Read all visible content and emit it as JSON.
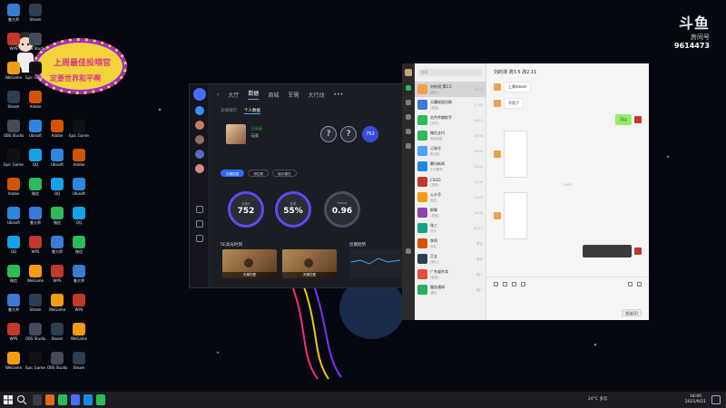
{
  "stream_overlay": {
    "banner_line1": "上周最佳投喂官",
    "banner_line2": "定要世界和平啊",
    "logo_brand": "斗鱼",
    "logo_room": "房间号",
    "room_id": "9614473"
  },
  "desktop_icons": [
    {
      "label": "鲁大师",
      "color": "#3a7bd5"
    },
    {
      "label": "WPS",
      "color": "#c0392b"
    },
    {
      "label": "WeGame",
      "color": "#f39c12"
    },
    {
      "label": "Steam",
      "color": "#2c3e50"
    },
    {
      "label": "OBS Studio",
      "color": "#444a58"
    },
    {
      "label": "Epic Games",
      "color": "#111111"
    },
    {
      "label": "Adobe",
      "color": "#d35400"
    },
    {
      "label": "Ubisoft",
      "color": "#2e86de"
    },
    {
      "label": "QQ",
      "color": "#17a2e8"
    },
    {
      "label": "微信",
      "color": "#2bbb5a"
    }
  ],
  "game_app": {
    "tabs": [
      "大厅",
      "数据",
      "商城",
      "军需",
      "大行动",
      "•••"
    ],
    "active_tab": "数据",
    "subtabs": [
      "天梯排行",
      "个人数据"
    ],
    "profile_tag": "已认证",
    "profile_name": "玩家",
    "rank_badge": "752",
    "q_mark": "?",
    "mode_buttons": [
      "天梯匹配",
      "排位赛",
      "娱乐模式"
    ],
    "stats": [
      {
        "caption": "天梯分",
        "value": "752"
      },
      {
        "caption": "胜率",
        "value": "55%"
      },
      {
        "caption": "Rating",
        "value": "0.96"
      }
    ],
    "videos_title": "5E高光时刻",
    "videos": [
      "天梯匹配",
      "天梯匹配"
    ],
    "trend_title": "近期趋势"
  },
  "wechat": {
    "search_placeholder": "搜索",
    "conversation_title": "刘的测 渭3.5 改2.11",
    "chats": [
      {
        "name": "刘的测 渭3.5",
        "preview": "[图片]",
        "time": "18:05",
        "color": "#f0a04b"
      },
      {
        "name": "天翼校园兑换",
        "preview": "[链接]",
        "time": "17:40",
        "color": "#3a7bd5"
      },
      {
        "name": "文件传输助手",
        "preview": "[文件]",
        "time": "16:12",
        "color": "#2bbb5a"
      },
      {
        "name": "微信支付",
        "preview": "收款到账",
        "time": "15:30",
        "color": "#2bbb5a"
      },
      {
        "name": "订阅号",
        "preview": "新消息",
        "time": "14:58",
        "color": "#4aa3ff"
      },
      {
        "name": "腾讯新闻",
        "preview": "今日要闻",
        "time": "13:20",
        "color": "#1e88e5"
      },
      {
        "name": "CSGO",
        "preview": "[语音]",
        "time": "12:45",
        "color": "#c0392b"
      },
      {
        "name": "公众号",
        "preview": "推送",
        "time": "11:02",
        "color": "#f39c12"
      },
      {
        "name": "群聊",
        "preview": "[表情]",
        "time": "10:30",
        "color": "#8e44ad"
      },
      {
        "name": "张三",
        "preview": "好的",
        "time": "09:15",
        "color": "#16a085"
      },
      {
        "name": "李四",
        "preview": "收到",
        "time": "昨天",
        "color": "#d35400"
      },
      {
        "name": "王五",
        "preview": "[图片]",
        "time": "昨天",
        "color": "#2c3e50"
      },
      {
        "name": "广东省外卖",
        "preview": "[链接]",
        "time": "周一",
        "color": "#e74c3c"
      },
      {
        "name": "服务通知",
        "preview": "通知",
        "time": "周一",
        "color": "#27ae60"
      }
    ],
    "messages": {
      "in1": "上周steam",
      "in2": "不用了",
      "out1": "可以",
      "time1": "18:02"
    },
    "send_label": "发送(S)"
  },
  "taskbar": {
    "weather": "24°C 多云",
    "time": "18:00",
    "date": "2021/9/21"
  }
}
